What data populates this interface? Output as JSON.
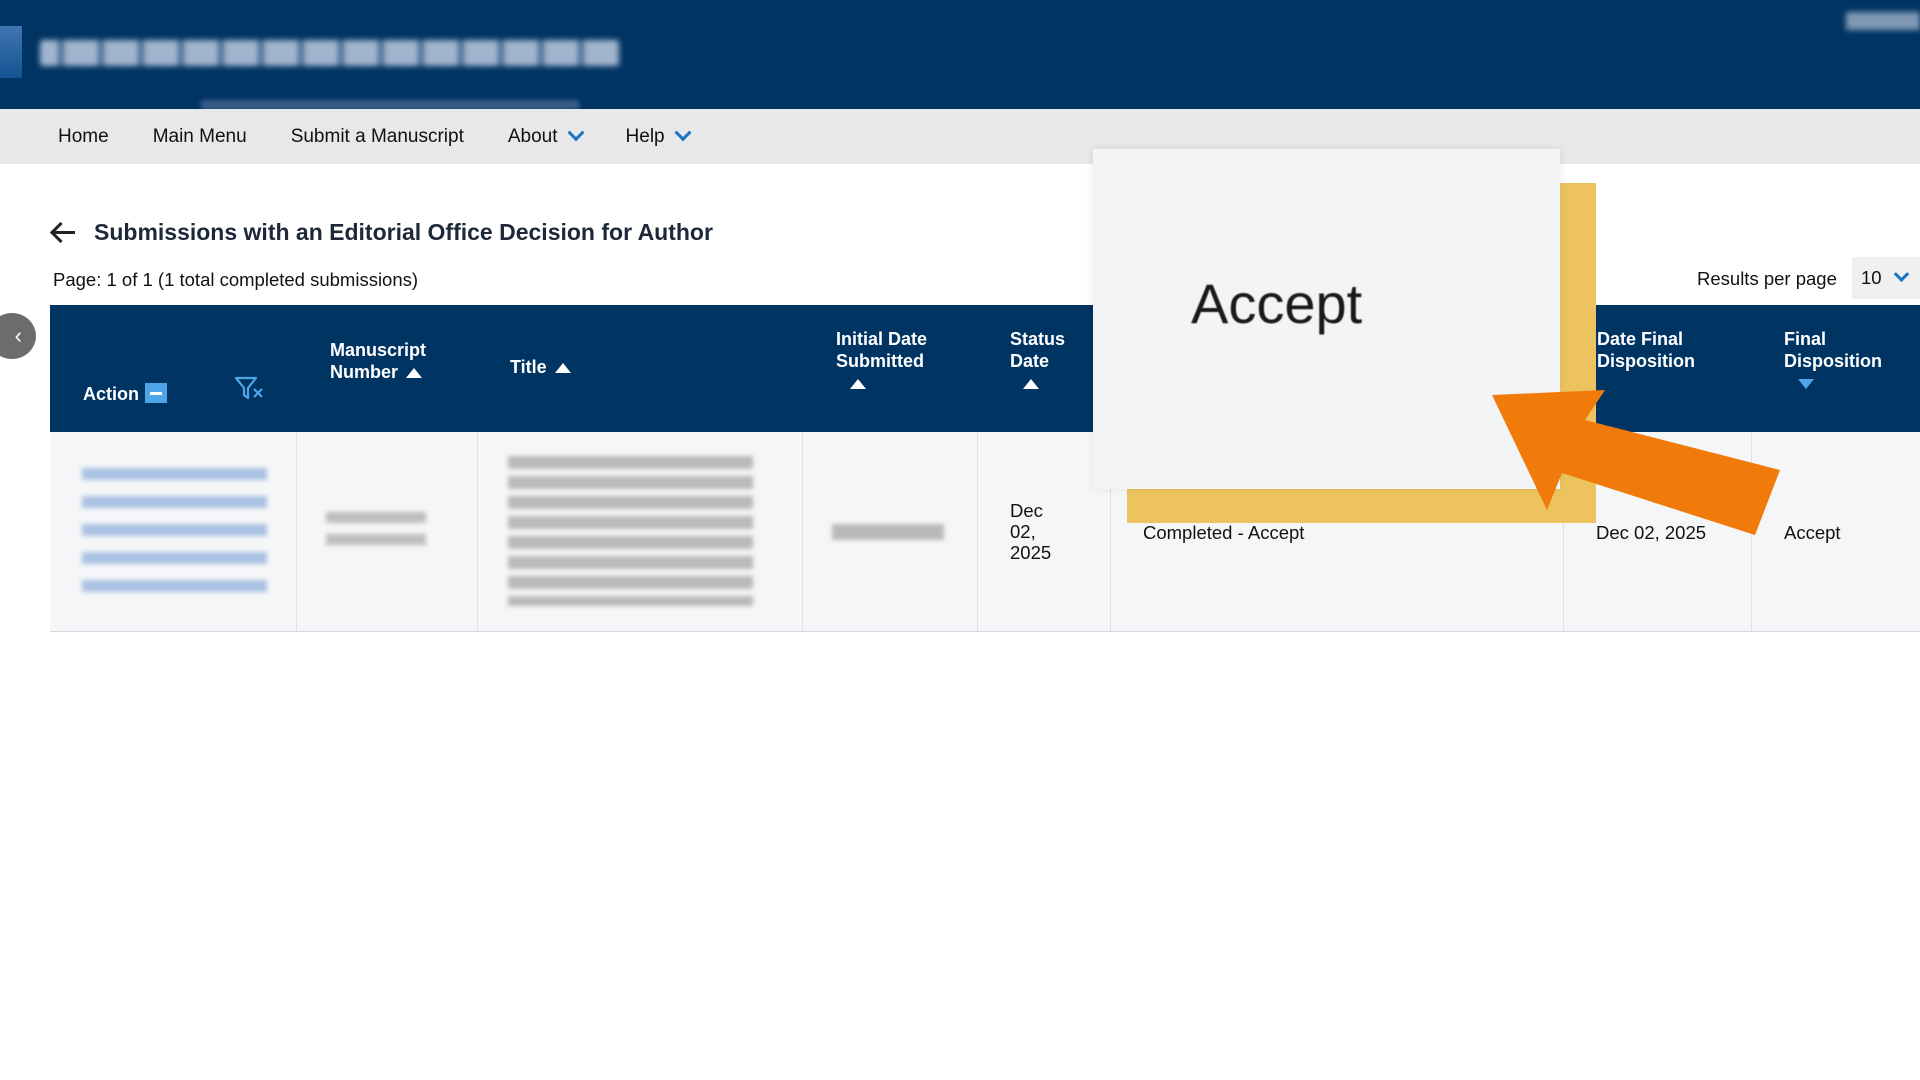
{
  "nav": {
    "items": [
      {
        "label": "Home",
        "dropdown": false
      },
      {
        "label": "Main Menu",
        "dropdown": false
      },
      {
        "label": "Submit a Manuscript",
        "dropdown": false
      },
      {
        "label": "About",
        "dropdown": true
      },
      {
        "label": "Help",
        "dropdown": true
      }
    ]
  },
  "page": {
    "title": "Submissions with an Editorial Office Decision for Author",
    "page_info": "Page: 1 of 1 (1 total completed submissions)",
    "results_per_page_label": "Results per page",
    "results_per_page_value": "10"
  },
  "table": {
    "headers": {
      "action": "Action",
      "manuscript_number": "Manuscript Number",
      "title": "Title",
      "initial_date_submitted": "Initial Date Submitted",
      "status_date": "Status Date",
      "date_final_disposition": "Date Final Disposition",
      "final_disposition": "Final Disposition"
    },
    "row": {
      "status_date": "Dec 02, 2025",
      "status": "Completed - Accept",
      "date_final_disposition": "Dec 02, 2025",
      "final_disposition": "Accept"
    }
  },
  "callout": {
    "text": "Accept"
  },
  "colors": {
    "banner": "#003463",
    "nav_bg": "#e6e8ea",
    "accent_blue": "#1c73c4",
    "callout_shadow": "#ecc35f",
    "arrow": "#f07b0a"
  },
  "icons": [
    "back-arrow-icon",
    "filter-clear-icon",
    "sort-asc-icon",
    "sort-desc-icon",
    "chevron-down-icon",
    "chevron-left-icon"
  ]
}
